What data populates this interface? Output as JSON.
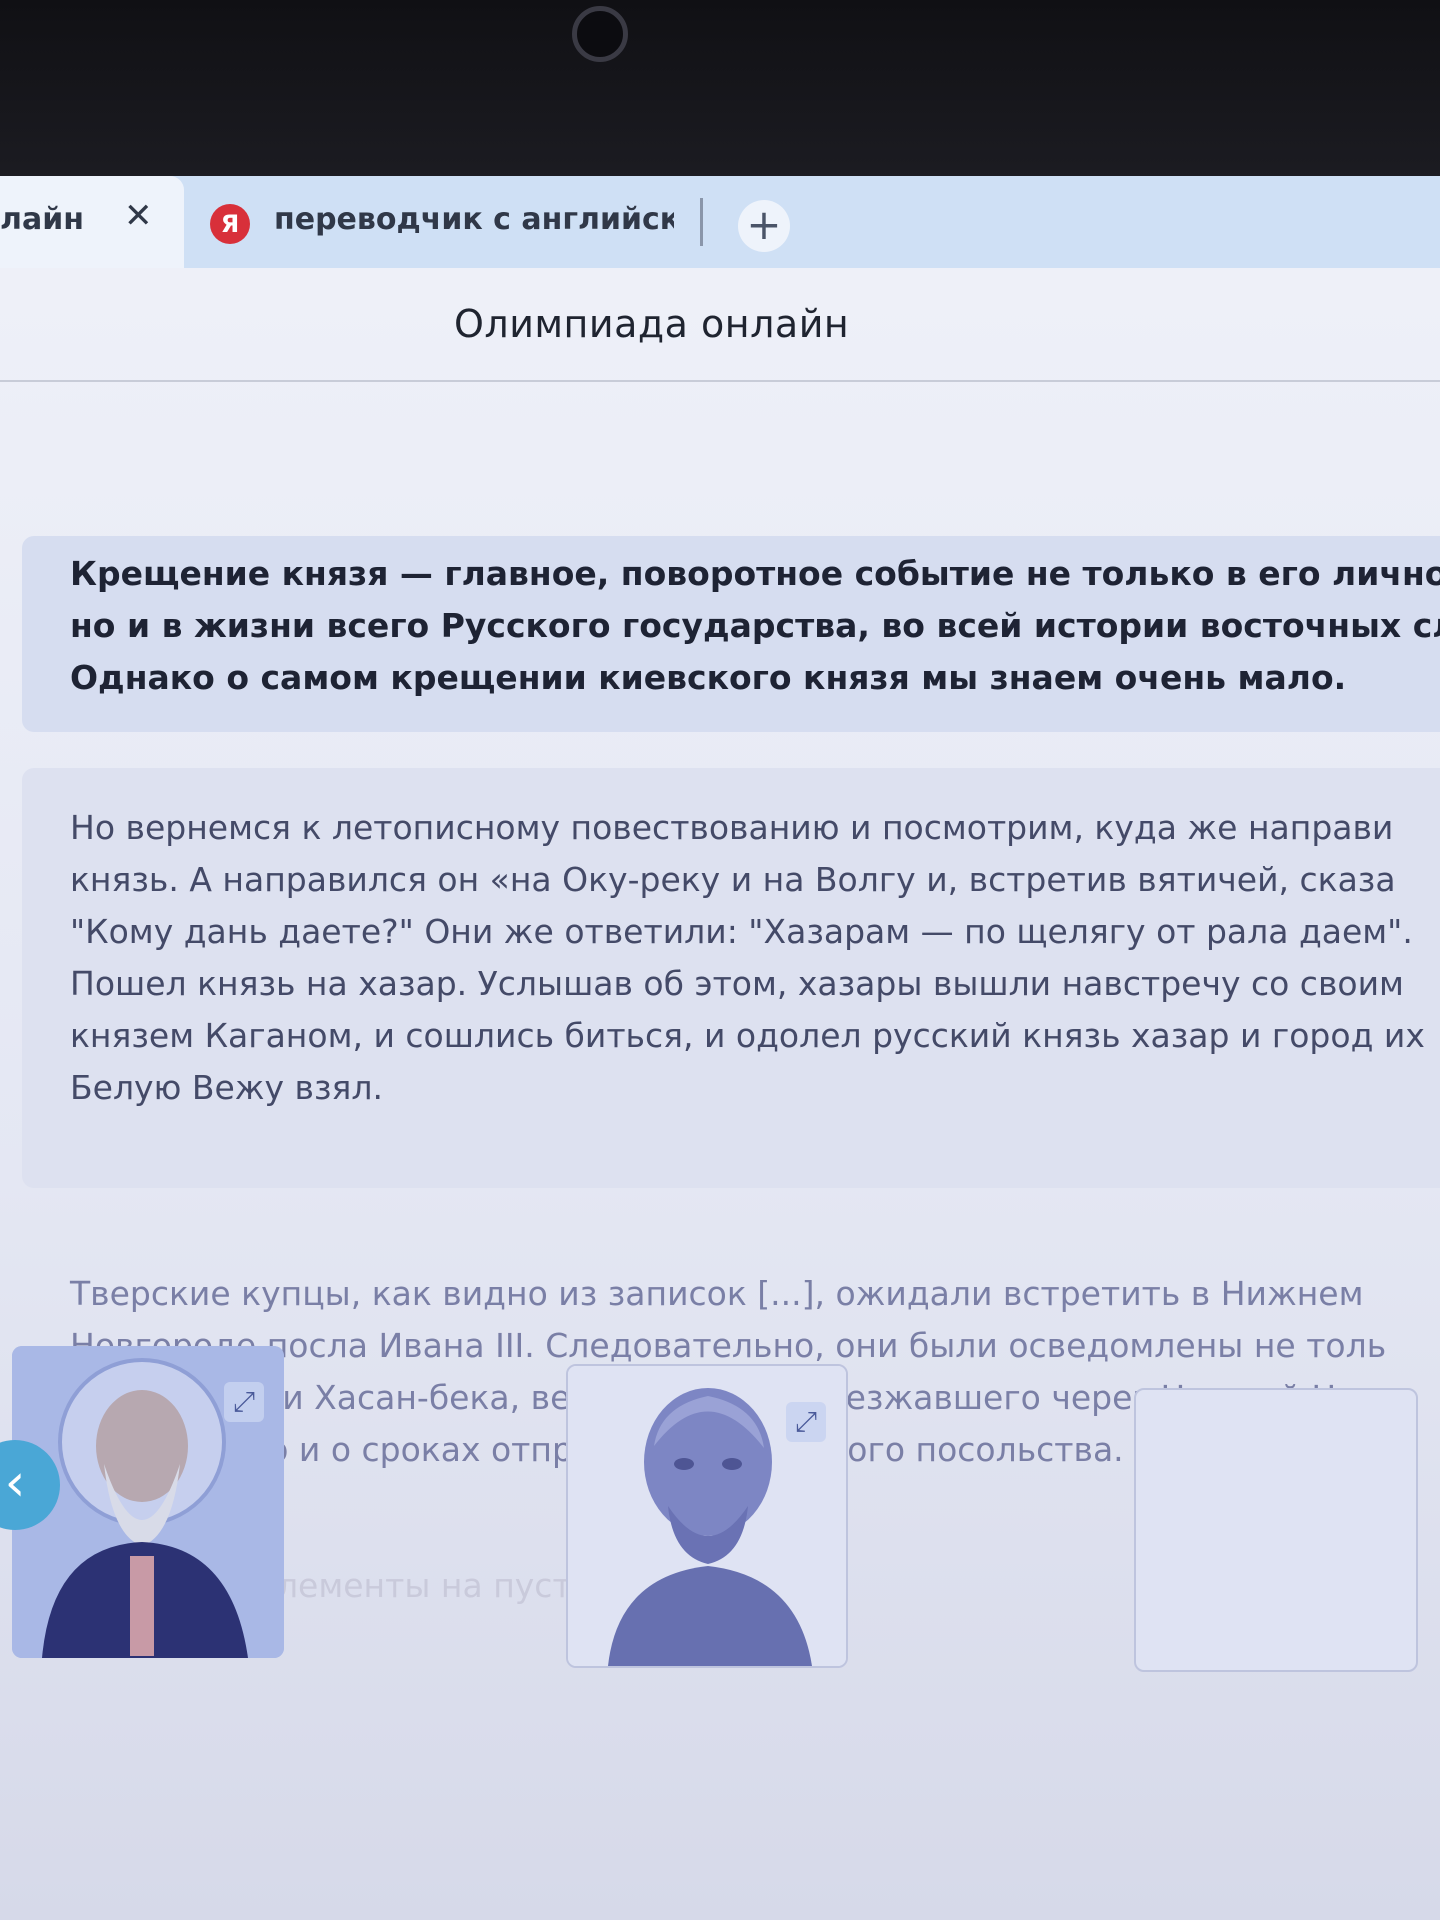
{
  "tabs": {
    "previous_label": "лайн",
    "close_symbol": "✕",
    "active_icon_letter": "Я",
    "active_label": "переводчик с английског",
    "new_tab_symbol": "+"
  },
  "page": {
    "title": "Олимпиада онлайн"
  },
  "cards": [
    {
      "lines": [
        "Крещение князя — главное, поворотное событие не только в его личной ж",
        "но и в жизни всего Русского государства, во всей истории восточных слав",
        "Однако о самом крещении киевского князя мы знаем очень мало."
      ]
    },
    {
      "lines": [
        "Но вернемся к летописному повествованию и посмотрим, куда же направи",
        "князь. А направился он «на Оку-реку и на Волгу и, встретив вятичей, сказа",
        "\"Кому дань даете?\" Они же ответили: \"Хазарам — по щелягу от рала даем\".",
        "Пошел князь на хазар. Услышав об этом, хазары вышли навстречу со своим",
        "князем Каганом, и сошлись биться, и одолел русский князь хазар и город их",
        "Белую Вежу взял."
      ]
    },
    {
      "lines": [
        "Тверские купцы, как видно из записок [...], ожидали встретить в Нижнем",
        "Новгороде посла Ивана III. Следовательно, они были осведомлены не толь",
        "возвращении Хасан-бека, вероятно уже проезжавшего через Нижний Новг",
        "в Москву, но и о сроках отправления ответного посольства."
      ]
    }
  ],
  "hint": "*Перетащите элементы на пустые поля сверху",
  "drag_items": [
    {
      "icon": "icon-portrait-monk"
    },
    {
      "icon": "bust-sculpture"
    }
  ],
  "colors": {
    "tab_strip": "#cfe0f5",
    "yandex_red": "#d8303a",
    "card_highlight": "#d6ddf0",
    "back_button": "#4aa7d6"
  }
}
